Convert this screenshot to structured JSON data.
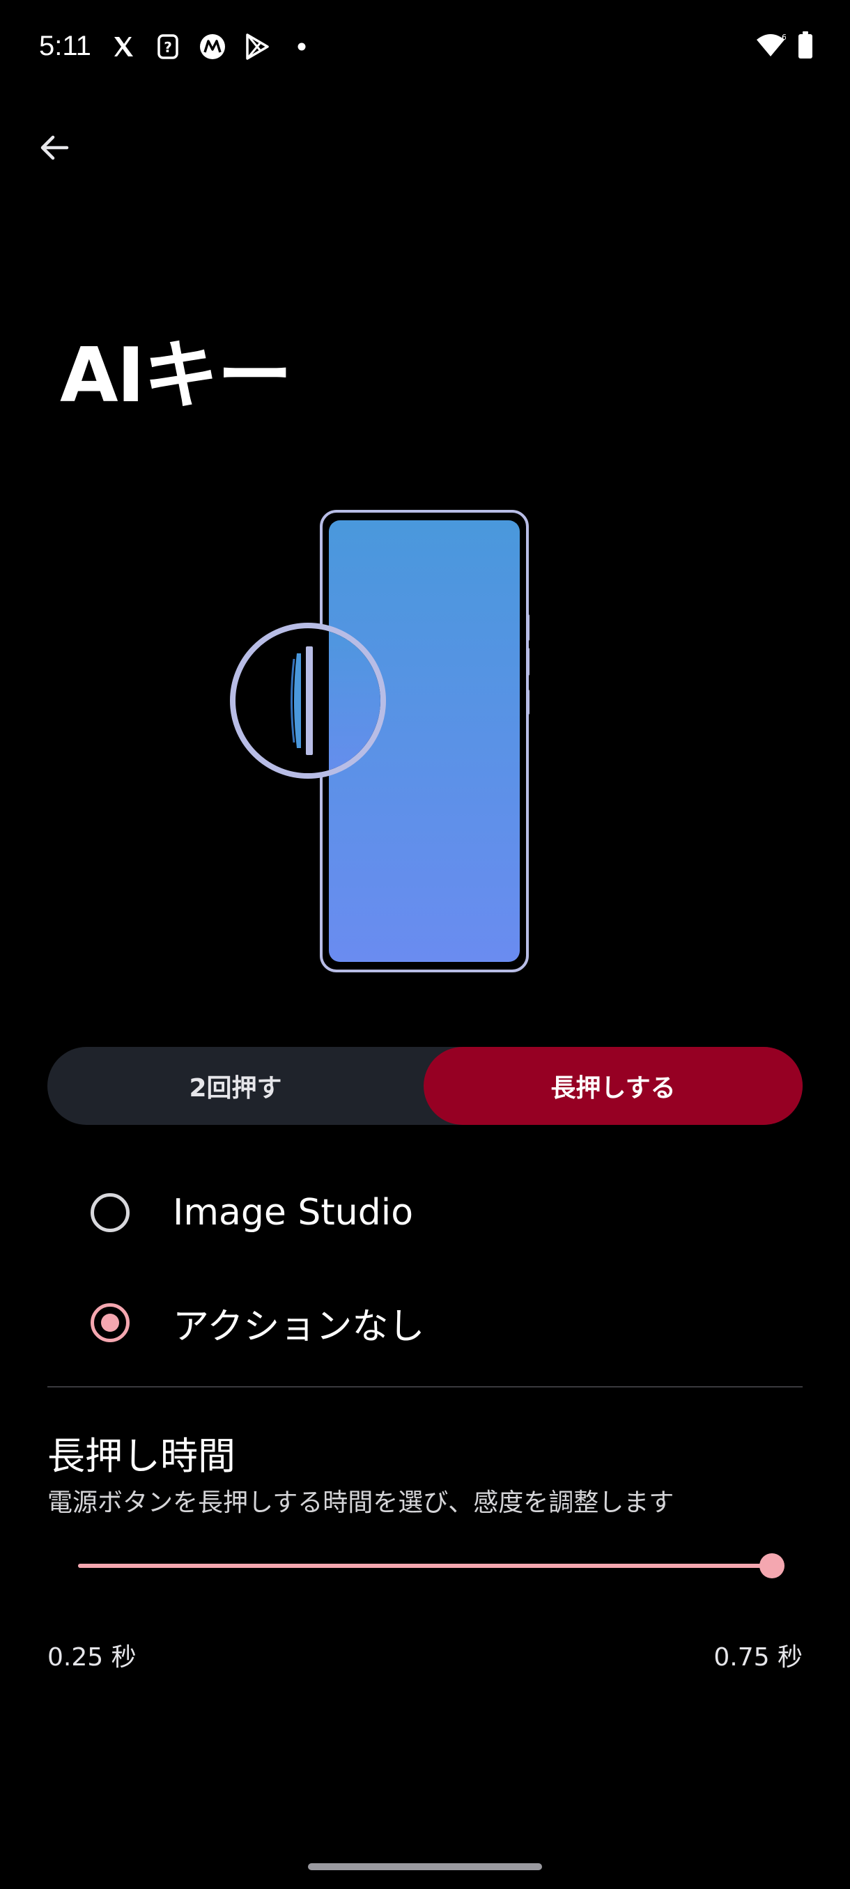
{
  "status_bar": {
    "time": "5:11",
    "left_icons": [
      "x-app-icon",
      "help-card-icon",
      "motorola-icon",
      "play-store-icon",
      "dot-icon"
    ],
    "right_icons": [
      "wifi-icon",
      "battery-icon"
    ]
  },
  "header": {
    "back_icon": "arrow-left-icon",
    "title": "AIキー"
  },
  "tabs": [
    {
      "label": "2回押す",
      "selected": false
    },
    {
      "label": "長押しする",
      "selected": true
    }
  ],
  "options": [
    {
      "label": "Image Studio",
      "selected": false
    },
    {
      "label": "アクションなし",
      "selected": true
    }
  ],
  "long_press": {
    "title": "長押し時間",
    "subtitle": "電源ボタンを長押しする時間を選び、感度を調整します",
    "slider_value_fraction": 1.0,
    "min_label": "0.25 秒",
    "max_label": "0.75 秒"
  },
  "colors": {
    "accent": "#f4a7b0",
    "selected_tab": "#960023",
    "tab_bg": "#1f232b",
    "phone_screen_top": "#4a98dc",
    "phone_screen_bottom": "#6a8cf0",
    "outline": "#b8bde6"
  }
}
